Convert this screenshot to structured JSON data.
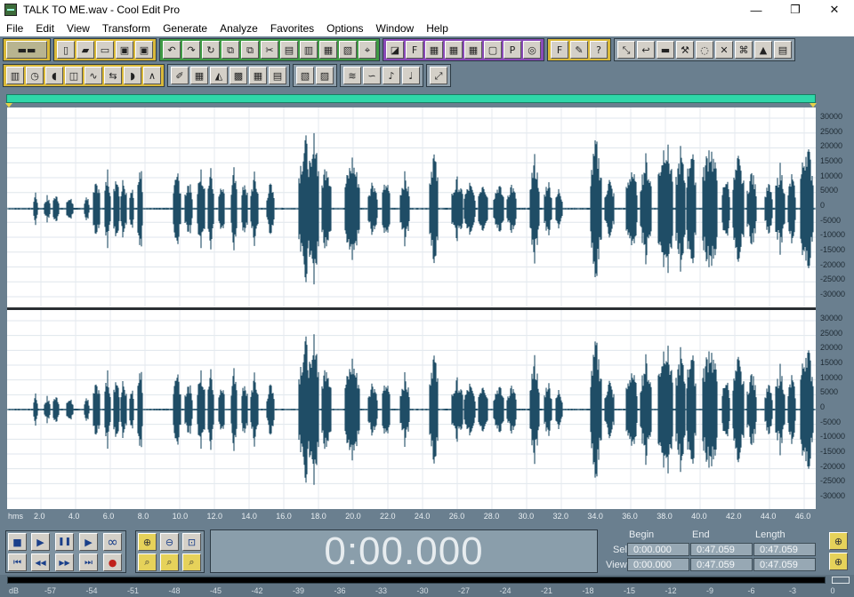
{
  "window": {
    "title": "TALK TO ME.wav - Cool Edit Pro",
    "controls": {
      "minimize": "—",
      "restore": "❐",
      "close": "✕"
    }
  },
  "menu": [
    "File",
    "Edit",
    "View",
    "Transform",
    "Generate",
    "Analyze",
    "Favorites",
    "Options",
    "Window",
    "Help"
  ],
  "toolbar_row1": {
    "groups": [
      {
        "color": "g-first",
        "buttons": [
          "multitrack-view-icon"
        ]
      },
      {
        "color": "g-yellow",
        "buttons": [
          "new-file-icon",
          "open-file-icon",
          "close-file-icon",
          "save-as-icon",
          "save-icon"
        ]
      },
      {
        "color": "g-green",
        "buttons": [
          "undo-icon",
          "redo-icon",
          "repeat-icon",
          "copy-new-icon",
          "copy-icon",
          "cut-icon",
          "paste-icon",
          "paste-new-icon",
          "mix-paste-icon",
          "trim-icon",
          "snap-icon"
        ]
      },
      {
        "color": "g-purple",
        "buttons": [
          "effects-icon",
          "fx-icon",
          "grid-a-icon",
          "grid-b-icon",
          "grid-c-icon",
          "doc-a-icon",
          "doc-b-icon",
          "cd-icon"
        ]
      },
      {
        "color": "g-yellow",
        "buttons": [
          "favorites-icon",
          "edit-note-icon",
          "help-icon"
        ]
      },
      {
        "color": "g-grey",
        "buttons": [
          "expand-icon",
          "return-icon",
          "flat-icon",
          "tools-icon",
          "bulb-icon",
          "cross-icon",
          "network-icon",
          "triangle-icon",
          "meter-icon"
        ]
      }
    ]
  },
  "toolbar_row2": {
    "groups": [
      {
        "color": "g-yellow",
        "buttons": [
          "bars-icon",
          "timer-icon",
          "envelope-icon",
          "graph-icon",
          "wave-icon",
          "delay-icon",
          "echo-icon",
          "peak-icon"
        ]
      },
      {
        "color": "g-grey",
        "buttons": [
          "brush-icon",
          "spectrum-icon",
          "analyze-icon",
          "frequency-icon",
          "grid-icon",
          "table-icon"
        ]
      },
      {
        "color": "g-grey",
        "buttons": [
          "mix-icon",
          "speed-icon"
        ]
      },
      {
        "color": "g-grey",
        "buttons": [
          "lines-icon",
          "loop-icon",
          "instrument-icon",
          "note-icon"
        ]
      },
      {
        "color": "g-grey",
        "buttons": [
          "fit-icon"
        ]
      }
    ]
  },
  "waveform": {
    "channel_scale": [
      "30000",
      "25000",
      "20000",
      "15000",
      "10000",
      "5000",
      "0",
      "-5000",
      "-10000",
      "-15000",
      "-20000",
      "-25000",
      "-30000"
    ],
    "ruler_unit": "hms",
    "ruler_ticks": [
      "2.0",
      "4.0",
      "6.0",
      "8.0",
      "10.0",
      "12.0",
      "14.0",
      "16.0",
      "18.0",
      "20.0",
      "22.0",
      "24.0",
      "26.0",
      "28.0",
      "30.0",
      "32.0",
      "34.0",
      "36.0",
      "38.0",
      "40.0",
      "42.0",
      "44.0",
      "46.0"
    ],
    "wave_color": "#1f4d66",
    "overview_color": "#2fd7a9"
  },
  "transport": {
    "time": "0:00.000",
    "headers": {
      "begin": "Begin",
      "end": "End",
      "length": "Length"
    },
    "sel": {
      "label": "Sel",
      "begin": "0:00.000",
      "end": "0:47.059",
      "length": "0:47.059"
    },
    "view": {
      "label": "View",
      "begin": "0:00.000",
      "end": "0:47.059",
      "length": "0:47.059"
    },
    "buttons": {
      "stop": "■",
      "play": "▶",
      "pause": "❚❚",
      "play_to_end": "▶",
      "loop": "∞",
      "go_start": "⏮",
      "rewind": "◀◀",
      "forward": "▶▶",
      "go_end": "⏭",
      "record": "●"
    }
  },
  "meter": {
    "label": "dB",
    "ticks": [
      "-57",
      "-54",
      "-51",
      "-48",
      "-45",
      "-42",
      "-39",
      "-36",
      "-33",
      "-30",
      "-27",
      "-24",
      "-21",
      "-18",
      "-15",
      "-12",
      "-9",
      "-6",
      "-3",
      "0"
    ]
  }
}
